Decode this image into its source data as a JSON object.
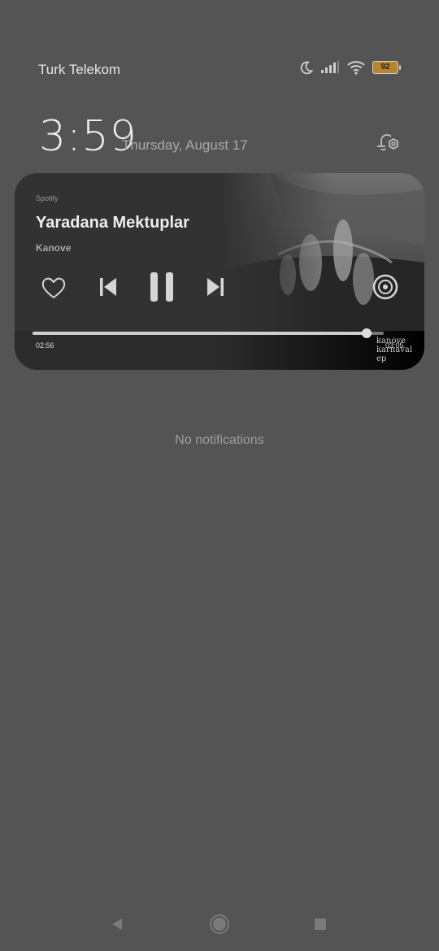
{
  "status_bar": {
    "carrier": "Turk Telekom",
    "icons": [
      "moon-icon",
      "signal-icon",
      "wifi-icon",
      "battery-icon"
    ],
    "battery_level": "92",
    "battery_color": "#b8862a"
  },
  "clock": {
    "time": "3:59",
    "date": "Thursday, August 17"
  },
  "settings_icon": "notification-settings-icon",
  "media_player": {
    "app_name": "Spotify",
    "title": "Yaradana Mektuplar",
    "artist": "Kanove",
    "elapsed": "02:56",
    "total": "03:05",
    "progress_fraction": 0.951,
    "album_art_caption_line1": "kanove",
    "album_art_caption_line2": "karnaval ep",
    "controls": [
      "heart-icon",
      "previous-icon",
      "pause-icon",
      "next-icon",
      "cast-icon"
    ]
  },
  "empty_state": "No notifications",
  "navigation": [
    "back-icon",
    "home-icon",
    "recents-icon"
  ]
}
